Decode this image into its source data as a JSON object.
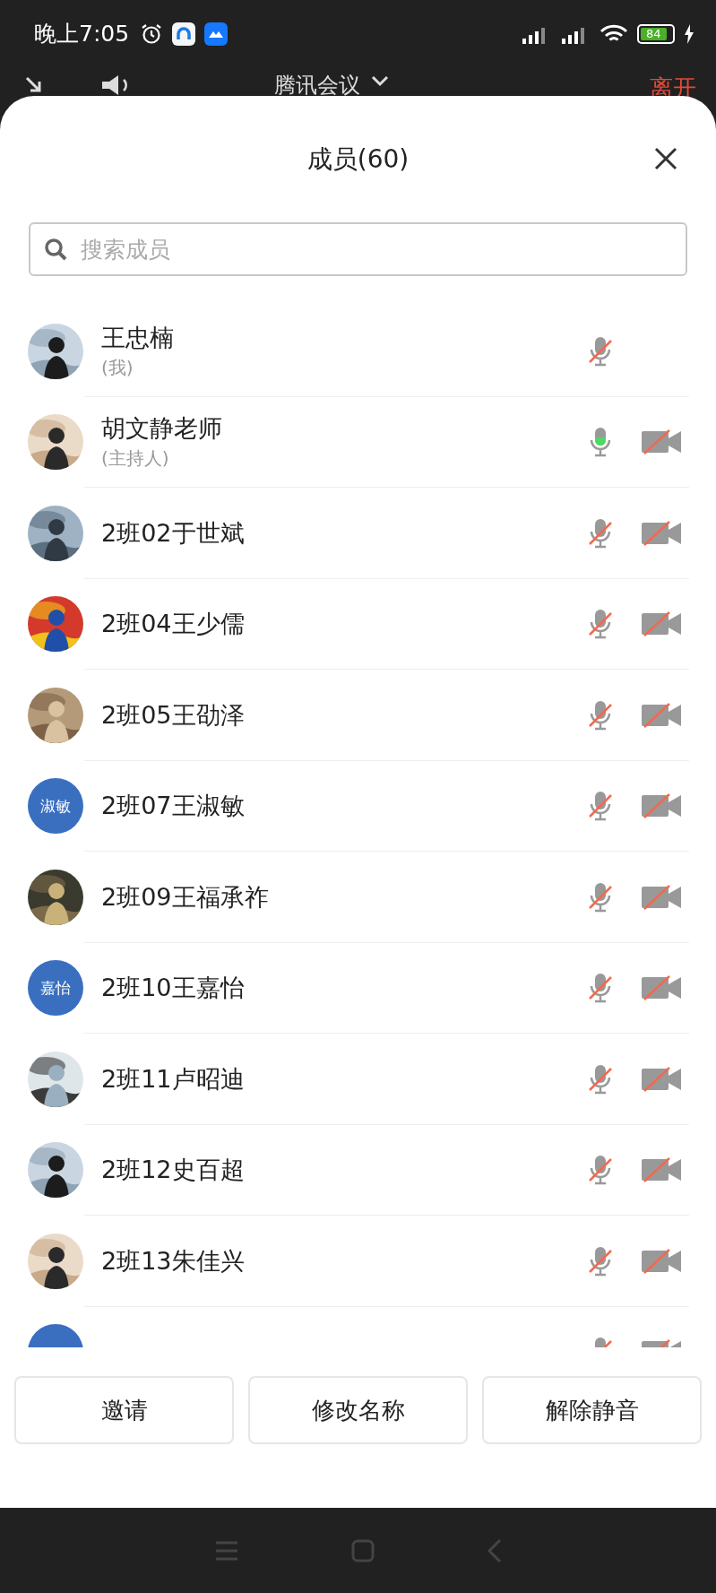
{
  "status_bar": {
    "time": "晚上7:05",
    "battery": "84",
    "charging": true
  },
  "meeting_bar": {
    "title": "腾讯会议",
    "leave": "离开"
  },
  "panel": {
    "title": "成员(60)",
    "search": {
      "placeholder": "搜索成员"
    }
  },
  "members": [
    {
      "name": "王忠楠",
      "role": "(我)",
      "mic_muted": true
    },
    {
      "name": "胡文静老师",
      "role": "(主持人)",
      "mic_muted": false,
      "camera_off": true
    },
    {
      "name": "2班02于世斌",
      "mic_muted": true,
      "camera_off": true
    },
    {
      "name": "2班04王少儒",
      "mic_muted": true,
      "camera_off": true
    },
    {
      "name": "2班05王劭泽",
      "mic_muted": true,
      "camera_off": true
    },
    {
      "name": "2班07王淑敏",
      "avatar": {
        "kind": "text",
        "text": "淑敏"
      },
      "mic_muted": true,
      "camera_off": true
    },
    {
      "name": "2班09王福承祚",
      "mic_muted": true,
      "camera_off": true
    },
    {
      "name": "2班10王嘉怡",
      "avatar": {
        "kind": "text",
        "text": "嘉怡"
      },
      "mic_muted": true,
      "camera_off": true
    },
    {
      "name": "2班11卢昭迪",
      "mic_muted": true,
      "camera_off": true
    },
    {
      "name": "2班12史百超",
      "mic_muted": true,
      "camera_off": true
    },
    {
      "name": "2班13朱佳兴",
      "mic_muted": true,
      "camera_off": true
    },
    {
      "avatar": {
        "kind": "text"
      },
      "mic_muted": true,
      "camera_off": true
    }
  ],
  "buttons": [
    "邀请",
    "修改名称",
    "解除静音"
  ]
}
